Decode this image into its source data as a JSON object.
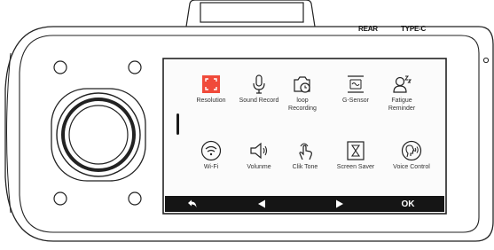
{
  "port_labels": {
    "rear": "REAR",
    "type_c": "TYPE-C"
  },
  "menu": {
    "items": [
      {
        "label": "Resolution",
        "icon": "resolution-icon",
        "selected": true
      },
      {
        "label": "Sound Record",
        "icon": "microphone-icon",
        "selected": false
      },
      {
        "label": "loop\nRecording",
        "icon": "loop-recording-icon",
        "selected": false
      },
      {
        "label": "G-Sensor",
        "icon": "g-sensor-icon",
        "selected": false
      },
      {
        "label": "Fatigue\nReminder",
        "icon": "fatigue-reminder-icon",
        "selected": false
      },
      {
        "label": "Wi-Fi",
        "icon": "wifi-icon",
        "selected": false
      },
      {
        "label": "Volunme",
        "icon": "speaker-icon",
        "selected": false
      },
      {
        "label": "Clik Tone",
        "icon": "tap-finger-icon",
        "selected": false
      },
      {
        "label": "Screen Saver",
        "icon": "hourglass-icon",
        "selected": false
      },
      {
        "label": "Voice Control",
        "icon": "voice-control-icon",
        "selected": false
      }
    ]
  },
  "softkeys": {
    "back_icon": "back-arrow-icon",
    "left_icon": "left-triangle-icon",
    "right_icon": "right-triangle-icon",
    "ok_label": "OK"
  },
  "colors": {
    "accent": "#f04a3a",
    "bar": "#151515",
    "outline": "#222222"
  }
}
